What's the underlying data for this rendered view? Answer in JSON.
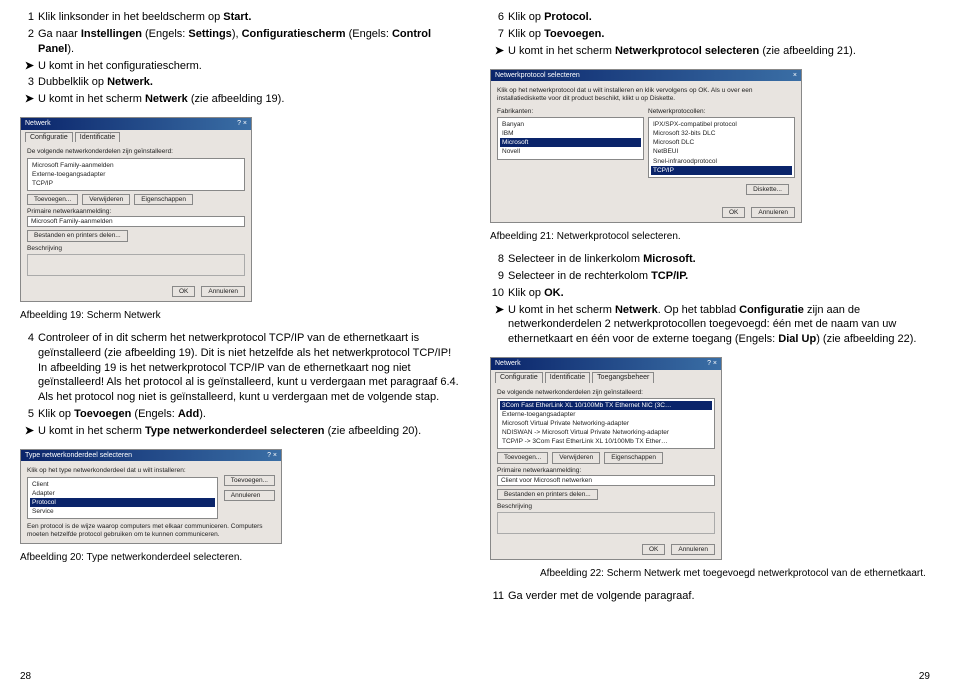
{
  "left": {
    "s1": "Klik linksonder in het beeldscherm op ",
    "s1b": "Start.",
    "s2a": "Ga naar ",
    "s2b": "Instellingen",
    "s2c": " (Engels: ",
    "s2d": "Settings",
    "s2e": "), ",
    "s2f": "Configuratiescherm",
    "s2g": " (Engels: ",
    "s2h": "Control Panel",
    "s2i": ").",
    "a1": "U komt in het configuratiescherm.",
    "s3a": "Dubbelklik op ",
    "s3b": "Netwerk.",
    "a2a": "U komt in het scherm ",
    "a2b": "Netwerk",
    "a2c": " (zie afbeelding 19).",
    "cap19": "Afbeelding 19: Scherm Netwerk",
    "s4": "Controleer of in dit scherm het netwerkprotocol TCP/IP van de ethernetkaart is geïnstalleerd (zie afbeelding 19). Dit is niet hetzelfde als het netwerkprotocol TCP/IP! In afbeelding 19 is het netwerkprotocol TCP/IP van de ethernetkaart nog niet geïnstalleerd! Als het protocol al is geïnstalleerd, kunt u verdergaan met paragraaf 6.4. Als het protocol nog niet is geïnstalleerd, kunt u verdergaan met de volgende stap.",
    "s5a": "Klik op ",
    "s5b": "Toevoegen",
    "s5c": " (Engels: ",
    "s5d": "Add",
    "s5e": ").",
    "a3a": "U komt in het scherm ",
    "a3b": "Type netwerkonderdeel selecteren",
    "a3c": " (zie afbeelding 20).",
    "cap20": "Afbeelding 20: Type netwerkonderdeel selecteren.",
    "pagenum": "28"
  },
  "right": {
    "s6a": "Klik op ",
    "s6b": "Protocol.",
    "s7a": "Klik op ",
    "s7b": "Toevoegen.",
    "a1a": "U komt in het scherm ",
    "a1b": "Netwerkprotocol selecteren",
    "a1c": " (zie afbeelding 21).",
    "cap21": "Afbeelding 21: Netwerkprotocol selecteren.",
    "s8a": "Selecteer in de linkerkolom ",
    "s8b": "Microsoft.",
    "s9a": "Selecteer in de rechterkolom ",
    "s9b": "TCP/IP.",
    "s10a": "Klik op ",
    "s10b": "OK.",
    "a2a": "U komt in het scherm ",
    "a2b": "Netwerk",
    "a2c": ". Op het tabblad ",
    "a2d": "Configuratie",
    "a2e": " zijn aan de netwerkonderdelen 2 netwerkprotocollen toegevoegd: één met de naam van uw ethernetkaart en één voor de externe toegang (Engels: ",
    "a2f": "Dial Up",
    "a2g": ") (zie afbeelding 22).",
    "cap22": "Afbeelding 22: Scherm Netwerk met toegevoegd netwerkprotocol van de ethernetkaart.",
    "s11": "Ga verder met de volgende paragraaf.",
    "pagenum": "29"
  },
  "dlg19": {
    "title": "Netwerk",
    "tab1": "Configuratie",
    "tab2": "Identificatie",
    "label1": "De volgende netwerkonderdelen zijn geïnstalleerd:",
    "item1": "Microsoft Family-aanmelden",
    "item2": "Externe-toegangsadapter",
    "item3": "TCP/IP",
    "btn1": "Toevoegen...",
    "btn2": "Verwijderen",
    "btn3": "Eigenschappen",
    "label2": "Primaire netwerkaanmelding:",
    "field2": "Microsoft Family-aanmelden",
    "btn4": "Bestanden en printers delen...",
    "label3": "Beschrijving",
    "ok": "OK",
    "cancel": "Annuleren"
  },
  "dlg20": {
    "title": "Type netwerkonderdeel selecteren",
    "label": "Klik op het type netwerkonderdeel dat u wilt installeren:",
    "item1": "Client",
    "item2": "Adapter",
    "item3": "Protocol",
    "item4": "Service",
    "btn1": "Toevoegen...",
    "btn2": "Annuleren",
    "desc": "Een protocol is de wijze waarop computers met elkaar communiceren. Computers moeten hetzelfde protocol gebruiken om te kunnen communiceren."
  },
  "dlg21": {
    "title": "Netwerkprotocol selecteren",
    "label": "Klik op het netwerkprotocol dat u wilt installeren en klik vervolgens op OK. Als u over een installatiediskette voor dit product beschikt, klikt u op Diskette.",
    "colL": "Fabrikanten:",
    "colR": "Netwerkprotocollen:",
    "l1": "Banyan",
    "l2": "IBM",
    "l3": "Microsoft",
    "l4": "Novell",
    "r1": "IPX/SPX-compatibel protocol",
    "r2": "Microsoft 32-bits DLC",
    "r3": "Microsoft DLC",
    "r4": "NetBEUI",
    "r5": "Snel-infraroodprotocol",
    "r6": "TCP/IP",
    "btn1": "Diskette...",
    "ok": "OK",
    "cancel": "Annuleren"
  },
  "dlg22": {
    "title": "Netwerk",
    "tab1": "Configuratie",
    "tab2": "Identificatie",
    "tab3": "Toegangsbeheer",
    "label1": "De volgende netwerkonderdelen zijn geïnstalleerd:",
    "item1": "3Com Fast EtherLink XL 10/100Mb TX Ethernet NIC (3C…",
    "item2": "Externe-toegangsadapter",
    "item3": "Microsoft Virtual Private Networking-adapter",
    "item4": "NDISWAN -> Microsoft Virtual Private Networking-adapter",
    "item5": "TCP/IP -> 3Com Fast EtherLink XL 10/100Mb TX Ether…",
    "btn1": "Toevoegen...",
    "btn2": "Verwijderen",
    "btn3": "Eigenschappen",
    "label2": "Primaire netwerkaanmelding:",
    "field2": "Client voor Microsoft netwerken",
    "btn4": "Bestanden en printers delen...",
    "label3": "Beschrijving",
    "ok": "OK",
    "cancel": "Annuleren"
  }
}
